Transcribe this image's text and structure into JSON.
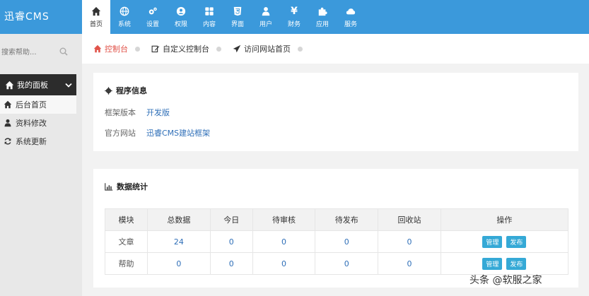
{
  "app": {
    "logo": "迅睿CMS"
  },
  "nav": {
    "items": [
      {
        "label": "首页",
        "icon": "home-icon"
      },
      {
        "label": "系统",
        "icon": "globe-icon"
      },
      {
        "label": "设置",
        "icon": "cogs-icon"
      },
      {
        "label": "权限",
        "icon": "user-circle-icon"
      },
      {
        "label": "内容",
        "icon": "grid-icon"
      },
      {
        "label": "界面",
        "icon": "html5-icon"
      },
      {
        "label": "用户",
        "icon": "user-icon"
      },
      {
        "label": "财务",
        "icon": "yen-icon"
      },
      {
        "label": "应用",
        "icon": "puzzle-icon"
      },
      {
        "label": "服务",
        "icon": "cloud-icon"
      }
    ],
    "active_index": 0
  },
  "sidebar": {
    "search_placeholder": "搜索帮助...",
    "panel_title": "我的面板",
    "items": [
      {
        "label": "后台首页",
        "icon": "home-icon"
      },
      {
        "label": "资料修改",
        "icon": "user-icon"
      },
      {
        "label": "系统更新",
        "icon": "refresh-icon"
      }
    ]
  },
  "tabs": [
    {
      "label": "控制台",
      "icon": "home-icon"
    },
    {
      "label": "自定义控制台",
      "icon": "edit-icon"
    },
    {
      "label": "访问网站首页",
      "icon": "send-icon"
    }
  ],
  "program_info": {
    "title": "程序信息",
    "rows": [
      {
        "key": "框架版本",
        "value": "开发版"
      },
      {
        "key": "官方网站",
        "value": "迅睿CMS建站框架"
      }
    ]
  },
  "stats": {
    "title": "数据统计",
    "headers": [
      "模块",
      "总数据",
      "今日",
      "待审核",
      "待发布",
      "回收站",
      "操作"
    ],
    "rows": [
      {
        "name": "文章",
        "values": [
          "24",
          "0",
          "0",
          "0",
          "0"
        ]
      },
      {
        "name": "帮助",
        "values": [
          "0",
          "0",
          "0",
          "0",
          "0"
        ]
      }
    ],
    "manage_label": "管理",
    "publish_label": "发布"
  },
  "watermark": "头条 @软服之家",
  "colors": {
    "topbar": "#3b99db",
    "accent_red": "#e1534a",
    "link": "#2f6fb8",
    "button": "#35a9d6"
  }
}
